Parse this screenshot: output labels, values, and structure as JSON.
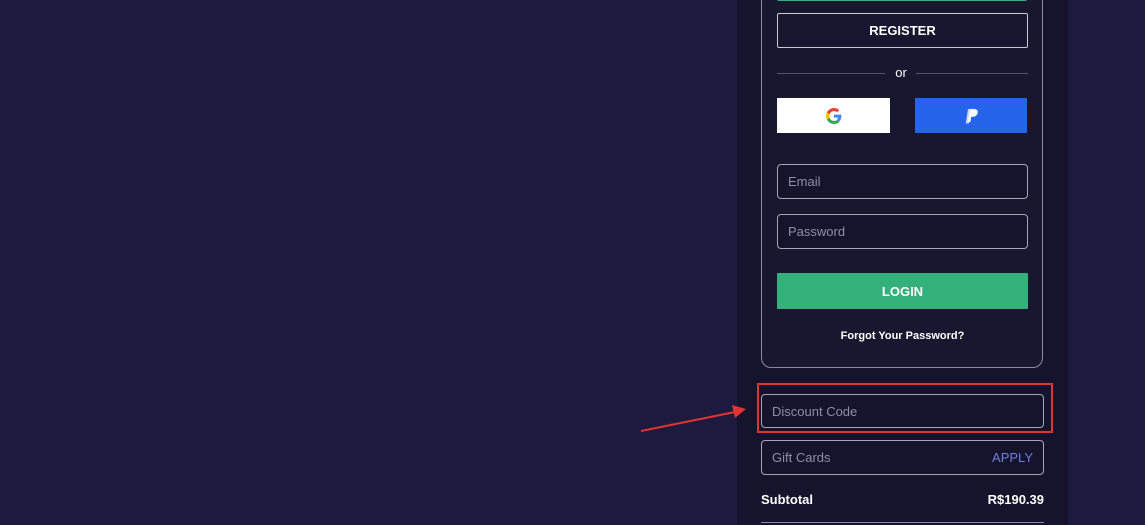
{
  "auth": {
    "register_label": "REGISTER",
    "divider_text": "or",
    "social": {
      "google_icon": "google-g-icon",
      "paypal_icon": "paypal-p-icon"
    },
    "email_placeholder": "Email",
    "password_placeholder": "Password",
    "login_label": "LOGIN",
    "forgot_label": "Forgot Your Password?"
  },
  "discount": {
    "placeholder": "Discount Code"
  },
  "gift_cards": {
    "placeholder": "Gift Cards",
    "apply_label": "APPLY"
  },
  "summary": {
    "subtotal_label": "Subtotal",
    "subtotal_value": "R$190.39"
  },
  "colors": {
    "background": "#1c1a3e",
    "panel": "#16142c",
    "accent_green": "#34b07a",
    "paypal_blue": "#2563eb",
    "apply_link": "#6d7ce0",
    "annotation_red": "#e23232"
  }
}
